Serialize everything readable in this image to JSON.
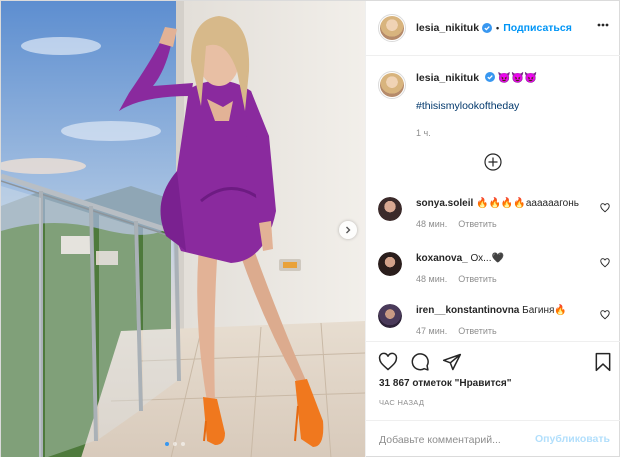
{
  "post": {
    "author": {
      "username": "lesia_nikituk",
      "verified": true
    },
    "follow_label": "Подписаться",
    "header_separator": "•",
    "caption": {
      "username": "lesia_nikituk",
      "emoji": "😈😈😈",
      "hashtag": "#thisismylookoftheday",
      "time": "1 ч."
    },
    "comments": [
      {
        "username": "sonya.soleil",
        "text": "🔥🔥🔥🔥аааааагонь",
        "time": "48 мин.",
        "reply_label": "Ответить"
      },
      {
        "username": "koxanova_",
        "text": "Ох...🖤",
        "time": "48 мин.",
        "reply_label": "Ответить"
      },
      {
        "username": "iren__konstantinovna",
        "text": "Багиня🔥",
        "time": "47 мин.",
        "reply_label": "Ответить"
      }
    ],
    "likes_text": "31 867 отметок \"Нравится\"",
    "posted_ago": "ЧАС НАЗАД",
    "comment_placeholder": "Добавьте комментарий...",
    "publish_label": "Опубликовать",
    "carousel": {
      "slides": 3,
      "active_index": 0
    },
    "icons": [
      "next-arrow-icon",
      "more-options-icon",
      "load-more-plus-icon",
      "like-icon",
      "comment-icon",
      "share-icon",
      "save-icon",
      "verified-badge-icon"
    ],
    "colors": {
      "accent": "#0095f6",
      "dress": "#8a2a9e",
      "shoes": "#f0781e",
      "publish_disabled": "#b2dffc"
    }
  }
}
